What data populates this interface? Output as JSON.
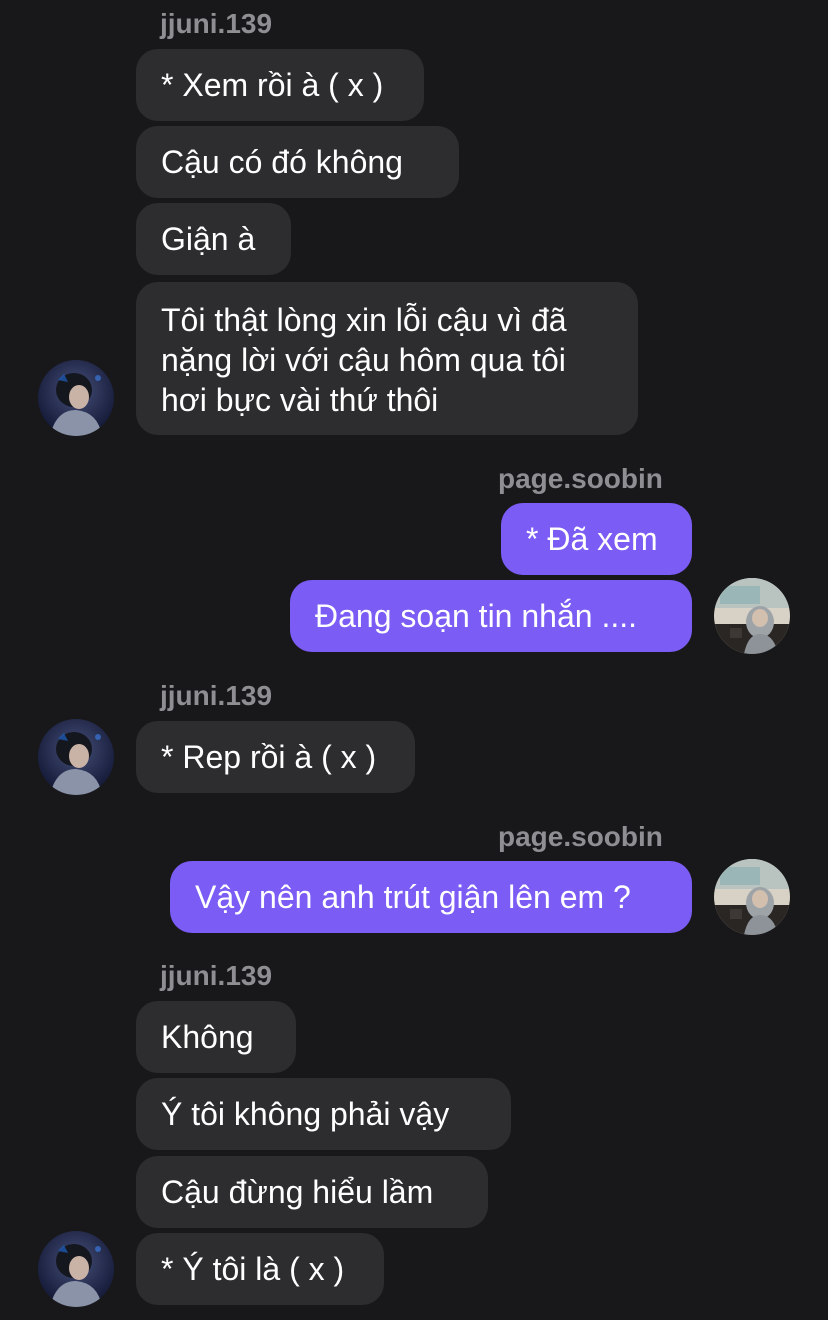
{
  "chat": {
    "sender_in_1": "jjuni.139",
    "msg_in_1": "* Xem rồi à ( x )",
    "msg_in_2": "Cậu có đó không",
    "msg_in_3": "Giận à",
    "msg_in_4": "Tôi thật lòng xin lỗi cậu vì đã nặng lời với cậu hôm qua tôi hơi bực vài thứ thôi",
    "sender_out_1": "page.soobin",
    "msg_out_1": "* Đã xem",
    "msg_out_2": "Đang soạn tin nhắn ....",
    "sender_in_2": "jjuni.139",
    "msg_in_5": "* Rep rồi à ( x )",
    "sender_out_2": "page.soobin",
    "msg_out_3": "Vậy nên anh trút giận lên em ?",
    "sender_in_3": "jjuni.139",
    "msg_in_6": "Không",
    "msg_in_7": "Ý tôi không phải vậy",
    "msg_in_8": "Cậu đừng hiểu lầm",
    "msg_in_9": "* Ý tôi là ( x )"
  },
  "colors": {
    "background": "#18181a",
    "incoming_bubble": "#2d2d30",
    "outgoing_bubble": "#7b5cf4",
    "sender_name": "#8e8e93",
    "text": "#ffffff"
  },
  "icons": {
    "incoming_avatar": "user-avatar-photo",
    "outgoing_avatar": "user-avatar-photo"
  }
}
